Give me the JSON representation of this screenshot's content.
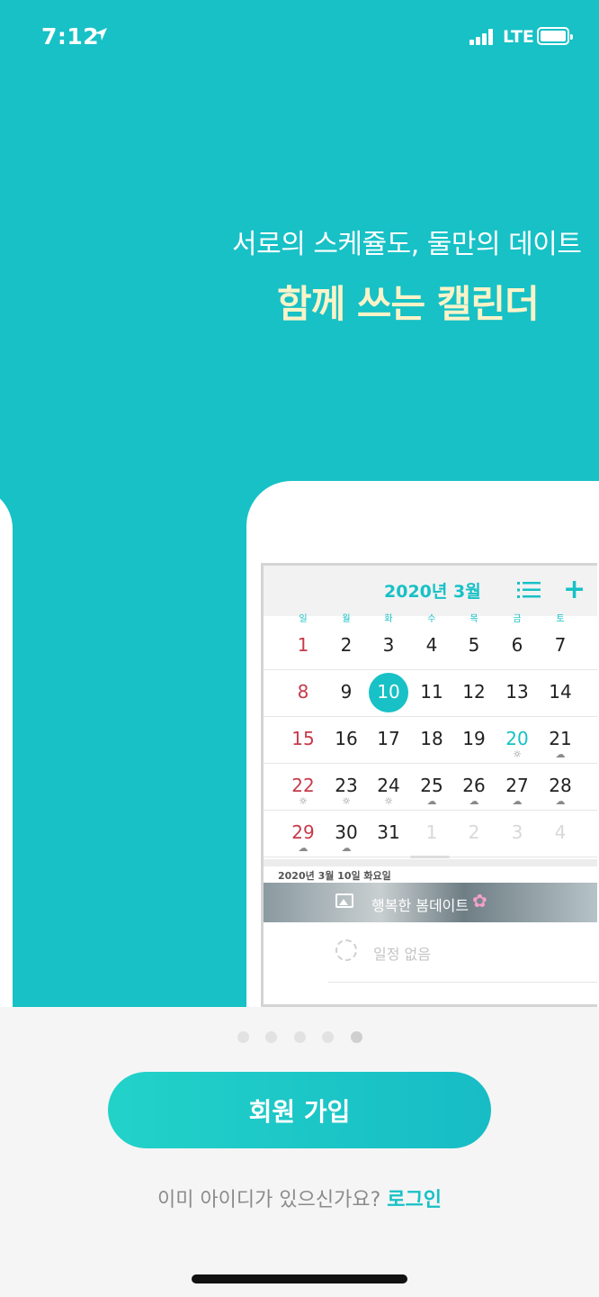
{
  "status_bar": {
    "time": "7:12",
    "network": "LTE"
  },
  "hero": {
    "subtitle": "서로의 스케쥴도, 둘만의 데이트",
    "title": "함께 쓰는 캘린더"
  },
  "calendar": {
    "title": "2020년 3월",
    "weekdays": [
      "일",
      "월",
      "화",
      "수",
      "목",
      "금",
      "토"
    ],
    "weeks": [
      [
        "1",
        "2",
        "3",
        "4",
        "5",
        "6",
        "7"
      ],
      [
        "8",
        "9",
        "10",
        "11",
        "12",
        "13",
        "14"
      ],
      [
        "15",
        "16",
        "17",
        "18",
        "19",
        "20",
        "21"
      ],
      [
        "22",
        "23",
        "24",
        "25",
        "26",
        "27",
        "28"
      ],
      [
        "29",
        "30",
        "31",
        "1",
        "2",
        "3",
        "4"
      ]
    ],
    "selected_day": "10",
    "selected_date_label": "2020년 3월 10일 화요일",
    "event_title": "행복한 봄데이트",
    "empty_text": "일정 없음",
    "weather": {
      "sun": "☼",
      "cloud": "☁"
    }
  },
  "pager": {
    "count": 5,
    "active_index": 4
  },
  "signup_button": "회원 가입",
  "login_prompt": "이미 아이디가 있으신가요?",
  "login_link": "로그인",
  "colors": {
    "accent": "#17c1c6",
    "title": "#fbf3c8",
    "sunday": "#c73a4a"
  }
}
